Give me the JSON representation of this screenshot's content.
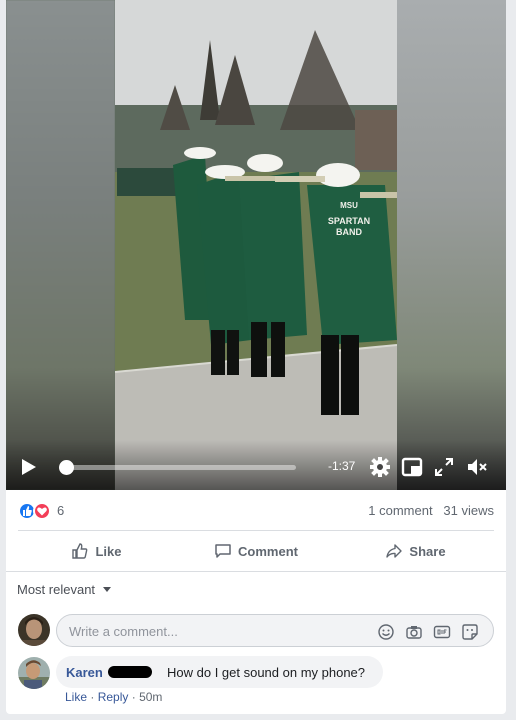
{
  "video": {
    "time_remaining": "-1:37",
    "progress": 0.0,
    "jacket_text_1": "SPARTAN",
    "jacket_text_2": "BAND",
    "jacket_text_3": "MSU"
  },
  "stats": {
    "reaction_count": "6",
    "comments": "1 comment",
    "views": "31 views"
  },
  "actions": {
    "like": "Like",
    "comment": "Comment",
    "share": "Share"
  },
  "sort_label": "Most relevant",
  "comment_box": {
    "placeholder": "Write a comment..."
  },
  "comments": [
    {
      "author": "Karen",
      "text": "How do I get sound on my phone?",
      "like": "Like",
      "reply": "Reply",
      "time": "50m"
    }
  ],
  "colors": {
    "link": "#385898",
    "like_blue": "#1877f2",
    "love_red": "#f33e58"
  }
}
